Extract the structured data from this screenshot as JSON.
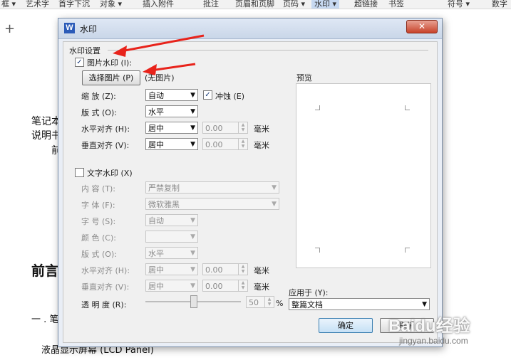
{
  "ribbon": {
    "items": [
      "框 ▾",
      "艺术字",
      "首字下沉",
      "对象 ▾",
      "插入附件",
      "批注",
      "页眉和页脚",
      "页码 ▾",
      "水印 ▾",
      "超链接",
      "书签",
      "符号 ▾",
      "数字"
    ],
    "active_index": 8
  },
  "document": {
    "line1": "笔记本",
    "line2": "说明书",
    "line3": "前",
    "heading": "前言",
    "item1": "一 . 笔",
    "item2": "液晶显示屏幕 (LCD Panel)"
  },
  "dialog": {
    "title": "水印",
    "close_label": "✕",
    "section_title": "水印设置",
    "picture_watermark": {
      "checkbox_label": "图片水印 (I):",
      "checked": true,
      "select_button": "选择图片 (P)",
      "no_picture": "(无图片)",
      "scale_label": "缩  放 (Z):",
      "scale_value": "自动",
      "washout_label": "冲蚀 (E)",
      "washout_checked": true,
      "layout_label": "版  式 (O):",
      "layout_value": "水平",
      "halign_label": "水平对齐 (H):",
      "halign_value": "居中",
      "halign_offset": "0.00",
      "halign_unit": "毫米",
      "valign_label": "垂直对齐 (V):",
      "valign_value": "居中",
      "valign_offset": "0.00",
      "valign_unit": "毫米"
    },
    "text_watermark": {
      "checkbox_label": "文字水印 (X)",
      "checked": false,
      "content_label": "内  容 (T):",
      "content_value": "严禁复制",
      "font_label": "字  体 (F):",
      "font_value": "微软雅黑",
      "size_label": "字  号 (S):",
      "size_value": "自动",
      "color_label": "颜  色 (C):",
      "layout_label": "版  式 (O):",
      "layout_value": "水平",
      "halign_label": "水平对齐 (H):",
      "halign_value": "居中",
      "halign_offset": "0.00",
      "halign_unit": "毫米",
      "valign_label": "垂直对齐 (V):",
      "valign_value": "居中",
      "valign_offset": "0.00",
      "valign_unit": "毫米",
      "transparency_label": "透 明 度 (R):",
      "transparency_value": "50",
      "transparency_unit": "%",
      "transparency_level": 0.5
    },
    "preview_label": "预览",
    "apply_to_label": "应用于 (Y):",
    "apply_to_value": "整篇文档",
    "ok_button": "确定",
    "cancel_button": "取消"
  },
  "watermark_logo": {
    "text": "Baidu经验",
    "subtext": "jingyan.baidu.com"
  },
  "colors": {
    "accent": "#c7d9f1",
    "arrow": "#e8231b",
    "title_bar": "#c9d6e8"
  }
}
